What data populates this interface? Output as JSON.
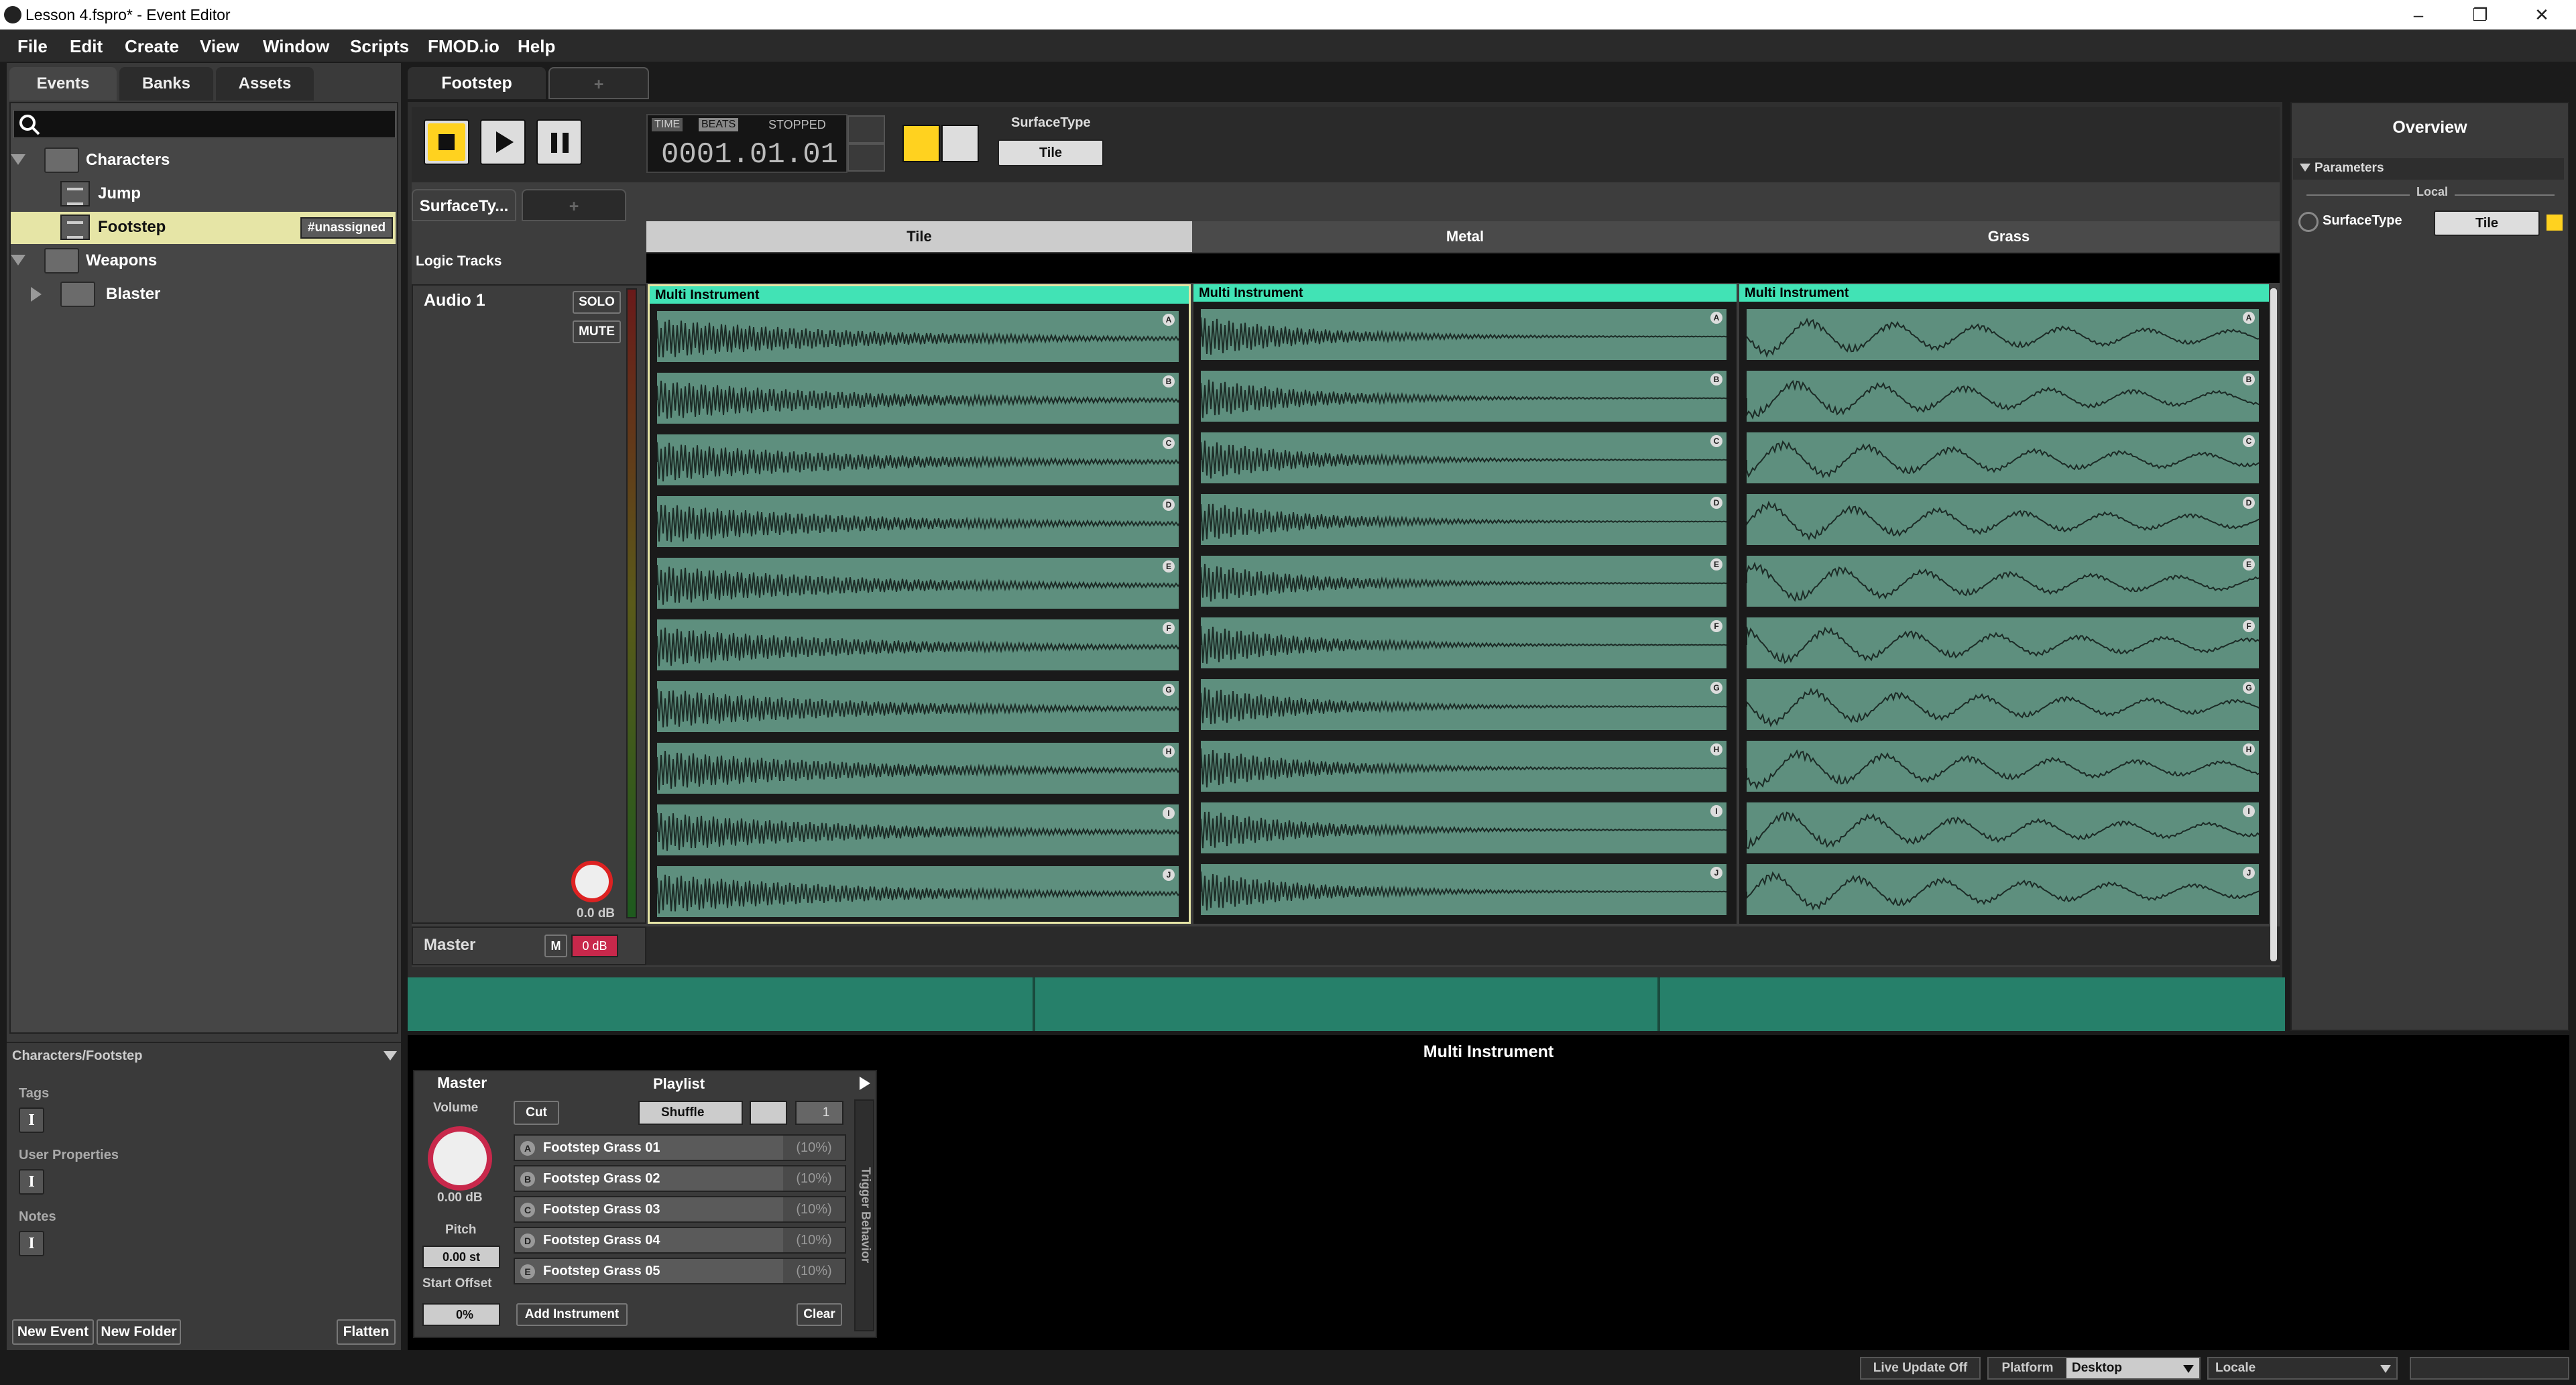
{
  "window": {
    "title": "Lesson 4.fspro* - Event Editor"
  },
  "menu": [
    "File",
    "Edit",
    "Create",
    "View",
    "Window",
    "Scripts",
    "FMOD.io",
    "Help"
  ],
  "browser": {
    "tabs": [
      "Events",
      "Banks",
      "Assets"
    ],
    "tree": {
      "characters": "Characters",
      "jump": "Jump",
      "footstep": "Footstep",
      "footstep_tag": "#unassigned",
      "weapons": "Weapons",
      "blaster": "Blaster"
    }
  },
  "properties": {
    "path": "Characters/Footstep",
    "tags": "Tags",
    "user_properties": "User Properties",
    "notes": "Notes",
    "new_event": "New Event",
    "new_folder": "New Folder",
    "flatten": "Flatten"
  },
  "editor": {
    "event_tab": "Footstep",
    "add_tab": "+",
    "time_label": "TIME",
    "beats_label": "BEATS",
    "state": "STOPPED",
    "position": "0001.01.01",
    "param_name": "SurfaceType",
    "param_value": "Tile",
    "sheet_tab": "SurfaceTy...",
    "lane_labels": [
      "Tile",
      "Metal",
      "Grass"
    ],
    "logic_tracks": "Logic Tracks",
    "track_name": "Audio 1",
    "solo": "SOLO",
    "mute": "MUTE",
    "track_volume": "0.0 dB",
    "master": "Master",
    "master_m": "M",
    "master_level": "0 dB",
    "instrument_title": "Multi Instrument",
    "clip_letters": [
      "A",
      "B",
      "C",
      "D",
      "E",
      "F",
      "G",
      "H",
      "I",
      "J"
    ]
  },
  "overview": {
    "title": "Overview",
    "parameters": "Parameters",
    "local": "Local",
    "param": "SurfaceType",
    "value": "Tile"
  },
  "deck": {
    "title": "Multi Instrument",
    "master": "Master",
    "volume_label": "Volume",
    "volume": "0.00 dB",
    "pitch_label": "Pitch",
    "pitch": "0.00 st",
    "start_offset_label": "Start Offset",
    "start_offset": "0%",
    "playlist": "Playlist",
    "cut": "Cut",
    "shuffle": "Shuffle",
    "count": "1",
    "items": [
      {
        "letter": "A",
        "name": "Footstep Grass 01",
        "pct": "(10%)"
      },
      {
        "letter": "B",
        "name": "Footstep Grass 02",
        "pct": "(10%)"
      },
      {
        "letter": "C",
        "name": "Footstep Grass 03",
        "pct": "(10%)"
      },
      {
        "letter": "D",
        "name": "Footstep Grass 04",
        "pct": "(10%)"
      },
      {
        "letter": "E",
        "name": "Footstep Grass 05",
        "pct": "(10%)"
      }
    ],
    "add_instrument": "Add Instrument",
    "clear": "Clear",
    "trigger_behavior": "Trigger Behavior"
  },
  "status": {
    "live_update": "Live Update Off",
    "platform_label": "Platform",
    "platform": "Desktop",
    "locale_label": "Locale"
  },
  "colors": {
    "accent": "#ffd21f",
    "instrument": "#41e3b5",
    "clip": "#5e8f7e",
    "timeline": "#26806a",
    "selection": "#e6e5a6"
  }
}
